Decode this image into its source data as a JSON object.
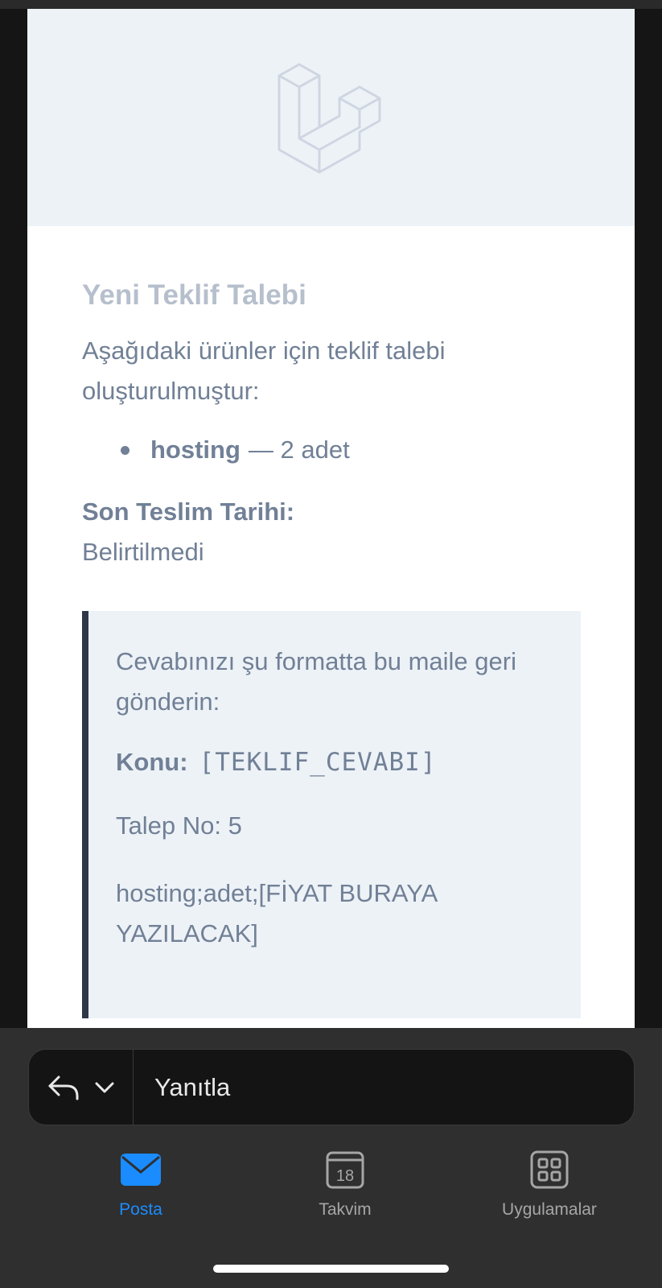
{
  "email": {
    "title": "Yeni Teklif Talebi",
    "intro": "Aşağıdaki ürünler için teklif talebi oluşturulmuştur:",
    "items": [
      {
        "name": "hosting",
        "detail": "— 2 adet"
      }
    ],
    "deadline_label": "Son Teslim Tarihi:",
    "deadline_value": "Belirtilmedi",
    "panel": {
      "instruction": "Cevabınızı şu formatta bu maile geri gönderin:",
      "subject_label": "Konu:",
      "subject_value": "[TEKLIF_CEVABI]",
      "request_no": "Talep No: 5",
      "format_line": "hosting;adet;[FİYAT BURAYA YAZILACAK]"
    }
  },
  "reply_bar": {
    "label": "Yanıtla"
  },
  "tabs": [
    {
      "label": "Posta",
      "icon": "mail-icon",
      "active": true
    },
    {
      "label": "Takvim",
      "icon": "calendar-icon",
      "day": "18",
      "active": false
    },
    {
      "label": "Uygulamalar",
      "icon": "apps-grid-icon",
      "active": false
    }
  ],
  "colors": {
    "accent": "#1a8cff",
    "header_bg": "#edf2f7",
    "text": "#718096",
    "title": "#b6bfcc",
    "panel_border": "#2d3748"
  }
}
